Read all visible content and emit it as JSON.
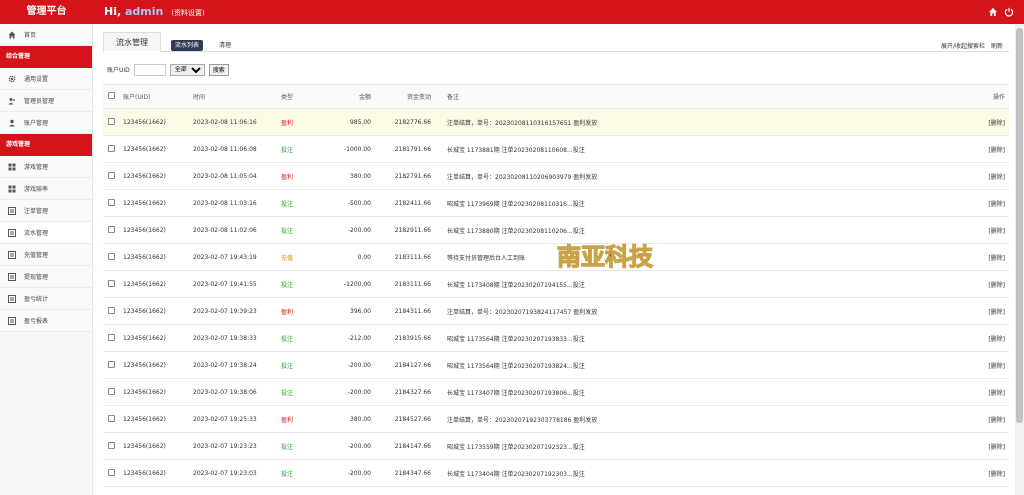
{
  "header": {
    "brand": "管理平台",
    "greeting": "Hi,",
    "username": "admin",
    "profile_link": "(资料设置)",
    "icons": [
      "home-icon",
      "power-icon"
    ]
  },
  "sidebar": {
    "home": "首页",
    "group1": "综合管理",
    "group1_items": [
      "通用设置",
      "管理员管理",
      "账户管理"
    ],
    "group2": "游戏管理",
    "group2_items": [
      "游戏管理",
      "游戏赔率",
      "注单管理",
      "流水管理",
      "充值管理",
      "提现管理",
      "盈亏统计",
      "盈亏报表"
    ]
  },
  "tabs": {
    "main": "流水管理",
    "active_sub": "流水列表",
    "sub2": "清理",
    "right_link1": "展开/收起搜索栏",
    "right_link2": "刷新"
  },
  "filter": {
    "label": "账户UID",
    "value": "",
    "select_value": "全部",
    "search_button": "搜索"
  },
  "table": {
    "headers": [
      "账户(UID)",
      "时间",
      "类型",
      "金额",
      "资金变动",
      "备注",
      "操作"
    ],
    "rows": [
      {
        "uid": "123456(1662)",
        "time": "2023-02-08 11:06:16",
        "type": "盈利",
        "color": "red",
        "amount": "985.00",
        "balance": "2182776.66",
        "note": "注单结算，单号：20230208110316157651 盈利发放",
        "op": "[删除]"
      },
      {
        "uid": "123456(1662)",
        "time": "2023-02-08 11:06:08",
        "type": "投注",
        "color": "green",
        "amount": "-1000.00",
        "balance": "2181791.66",
        "note": "长城宝 1173881期 注单20230208110608...投注",
        "op": "[删除]"
      },
      {
        "uid": "123456(1662)",
        "time": "2023-02-08 11:05:04",
        "type": "盈利",
        "color": "red",
        "amount": "380.00",
        "balance": "2182791.66",
        "note": "注单结算，单号：20230208110206903979 盈利发放",
        "op": "[删除]"
      },
      {
        "uid": "123456(1662)",
        "time": "2023-02-08 11:03:16",
        "type": "投注",
        "color": "green",
        "amount": "-500.00",
        "balance": "2182411.66",
        "note": "昭城宝 1173969期 注单20230208110316...投注",
        "op": "[删除]"
      },
      {
        "uid": "123456(1662)",
        "time": "2023-02-08 11:02:06",
        "type": "投注",
        "color": "green",
        "amount": "-200.00",
        "balance": "2182911.66",
        "note": "长城宝 1173880期 注单20230208110206...投注",
        "op": "[删除]"
      },
      {
        "uid": "123456(1662)",
        "time": "2023-02-07 19:43:19",
        "type": "充值",
        "color": "orange",
        "amount": "0.00",
        "balance": "2183111.66",
        "note": "等待支付员管理后台人工到账",
        "op": "[删除]"
      },
      {
        "uid": "123456(1662)",
        "time": "2023-02-07 19:41:55",
        "type": "投注",
        "color": "green",
        "amount": "-1200.00",
        "balance": "2183111.66",
        "note": "长城宝 1173408期 注单20230207194155...投注",
        "op": "[删除]"
      },
      {
        "uid": "123456(1662)",
        "time": "2023-02-07 19:39:23",
        "type": "盈利",
        "color": "red",
        "amount": "396.00",
        "balance": "2184311.66",
        "note": "注单结算，单号：20230207193824117457 盈利发放",
        "op": "[删除]"
      },
      {
        "uid": "123456(1662)",
        "time": "2023-02-07 19:38:33",
        "type": "投注",
        "color": "green",
        "amount": "-212.00",
        "balance": "2183915.66",
        "note": "昭城宝 1173564期 注单20230207193833...投注",
        "op": "[删除]"
      },
      {
        "uid": "123456(1662)",
        "time": "2023-02-07 19:38:24",
        "type": "投注",
        "color": "green",
        "amount": "-200.00",
        "balance": "2184127.66",
        "note": "昭城宝 1173564期 注单20230207193824...投注",
        "op": "[删除]"
      },
      {
        "uid": "123456(1662)",
        "time": "2023-02-07 19:38:06",
        "type": "投注",
        "color": "green",
        "amount": "-200.00",
        "balance": "2184327.66",
        "note": "长城宝 1173407期 注单20230207193806...投注",
        "op": "[删除]"
      },
      {
        "uid": "123456(1662)",
        "time": "2023-02-07 19:25:33",
        "type": "盈利",
        "color": "red",
        "amount": "380.00",
        "balance": "2184527.66",
        "note": "注单结算，单号：20230207192303778186 盈利发放",
        "op": "[删除]"
      },
      {
        "uid": "123456(1662)",
        "time": "2023-02-07 19:23:23",
        "type": "投注",
        "color": "green",
        "amount": "-200.00",
        "balance": "2184147.66",
        "note": "昭城宝 1173559期 注单20230207192323...投注",
        "op": "[删除]"
      },
      {
        "uid": "123456(1662)",
        "time": "2023-02-07 19:23:03",
        "type": "投注",
        "color": "green",
        "amount": "-200.00",
        "balance": "2184347.66",
        "note": "长城宝 1173404期 注单20230207192303...投注",
        "op": "[删除]"
      }
    ]
  },
  "watermark": "南亚科技",
  "colors": {
    "accent": "#d4141a",
    "profit": "#d4141a",
    "bet": "#2e9b2e",
    "recharge": "#e08a00"
  }
}
